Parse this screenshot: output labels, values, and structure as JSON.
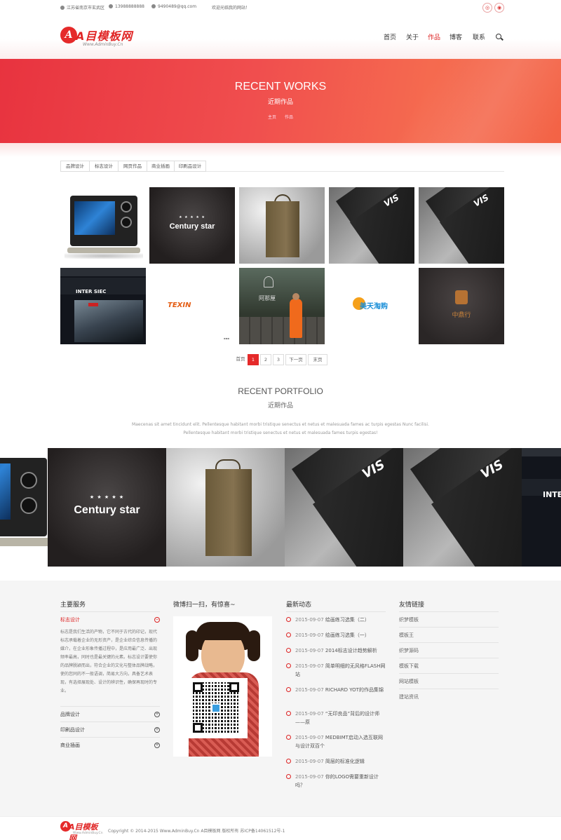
{
  "topbar": {
    "address": "江苏省南京市玄武区",
    "phone": "13988888888",
    "email": "9490489@qq.com",
    "welcome": "欢迎光临我的网站！"
  },
  "brand": {
    "name": "A目模板网",
    "sub": "Www.AdminBuy.Cn"
  },
  "nav": [
    "首页",
    "关于",
    "作品",
    "博客",
    "联系"
  ],
  "nav_active": "作品",
  "banner": {
    "title": "RECENT WORKS",
    "subtitle": "近期作品",
    "crumbs": [
      "主页",
      "作品"
    ]
  },
  "filters": [
    "品牌设计",
    "标志设计",
    "网页作品",
    "商业插画",
    "印刷品设计"
  ],
  "gallery": [
    {
      "kind": "tv-monitor"
    },
    {
      "kind": "century-star",
      "text": "Century star"
    },
    {
      "kind": "gift-bag"
    },
    {
      "kind": "vis-book",
      "text": "VIS"
    },
    {
      "kind": "vis-book",
      "text": "VIS"
    },
    {
      "kind": "website",
      "text": "INTER SIEC"
    },
    {
      "kind": "texin-logo",
      "text": "TEXIN"
    },
    {
      "kind": "monk-photo",
      "text": "阿那厘"
    },
    {
      "kind": "meitian-logo",
      "text": "美天淘购"
    },
    {
      "kind": "zhongding-logo",
      "text": "中鼎行"
    }
  ],
  "pager": {
    "first": "首页",
    "pages": [
      "1",
      "2",
      "3"
    ],
    "current": "1",
    "next": "下一页",
    "last": "末页"
  },
  "portfolio": {
    "title": "RECENT PORTFOLIO",
    "subtitle": "近期作品",
    "desc": "Maecenas sit amet tincidunt elit. Pellentesque habitant morbi tristique senectus et netus et malesuada fames ac turpis egestas Nunc facilisi. Pellentesque habitant morbi tristique senectus et netus et malesuada fames turpis egestas!"
  },
  "footer": {
    "services_title": "主要服务",
    "services": [
      {
        "label": "标志设计",
        "active": true
      },
      {
        "label": "品牌设计",
        "active": false
      },
      {
        "label": "印刷品设计",
        "active": false
      },
      {
        "label": "商业插画",
        "active": false
      }
    ],
    "service_desc": "标志是我们生活的产物，它不同于古代的印记，现代标志承载着企业的无形资产，是企业综合信息传播的媒介，在企业形象传播过程中，是应用最广泛、出现频率最高，同时也是最关键的元素。标志设计要使你的品牌脱颖而出，符合企业的文化与整体品牌战略，使的您同的不一般语调，简易大方向，具备艺术表现，有选择展现处、设计的辨识性，确保再现时的专业。",
    "weibo_title": "微博扫一扫，有惊喜~",
    "news_title": "最新动态",
    "news": [
      {
        "date": "2015-09-07",
        "text": "绘画练习选集（二）"
      },
      {
        "date": "2015-09-07",
        "text": "绘画练习选集（一）"
      },
      {
        "date": "2015-09-07",
        "text": "2014标志设计趋势解析"
      },
      {
        "date": "2015-09-07",
        "text": "简单明细的无风格FLASH网站"
      },
      {
        "date": "2015-09-07",
        "text": "RICHARD YOT的作品集锦"
      },
      {
        "date": "2015-09-07",
        "text": "“无印良品”背后的设计师——原"
      },
      {
        "date": "2015-09-07",
        "text": "MEDBIMT启动入选互联网与设计双百个"
      },
      {
        "date": "2015-09-07",
        "text": "简层的标准化逻辑"
      },
      {
        "date": "2015-09-07",
        "text": "你的LOGO需要重新设计吗？"
      }
    ],
    "links_title": "友情链接",
    "links": [
      "织梦模板",
      "模板王",
      "织梦源码",
      "模板下载",
      "网站模板",
      "建站资讯"
    ],
    "copyright": "Copyright © 2014-2015 Www.AdminBuy.Cn A目模板网 版权所有 苏ICP备14061512号-1"
  },
  "colors": {
    "accent": "#e52a2a",
    "banner_start": "#e8333f",
    "banner_end": "#f36346"
  }
}
